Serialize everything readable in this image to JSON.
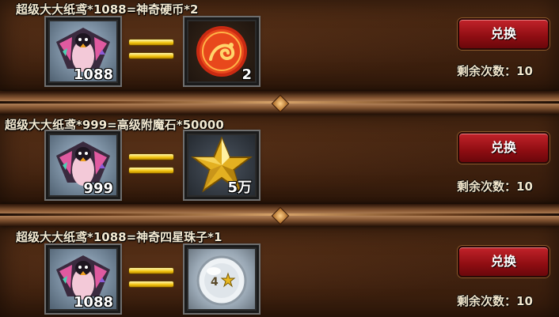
{
  "offers": [
    {
      "title": "超级大大纸鸢*1088=神奇硬币*2",
      "cost_icon": "kite-icon",
      "cost_count": "1088",
      "reward_icon": "dragon-coin-icon",
      "reward_count": "2",
      "button_label": "兑换",
      "remaining_label": "剩余次数：10"
    },
    {
      "title": "超级大大纸鸢*999=高级附魔石*50000",
      "cost_icon": "kite-icon",
      "cost_count": "999",
      "reward_icon": "star-gem-icon",
      "reward_count": "5万",
      "button_label": "兑换",
      "remaining_label": "剩余次数：10"
    },
    {
      "title": "超级大大纸鸢*1088=神奇四星珠子*1",
      "cost_icon": "kite-icon",
      "cost_count": "1088",
      "reward_icon": "four-star-orb-icon",
      "reward_count": "",
      "button_label": "兑换",
      "remaining_label": "剩余次数：10"
    }
  ]
}
